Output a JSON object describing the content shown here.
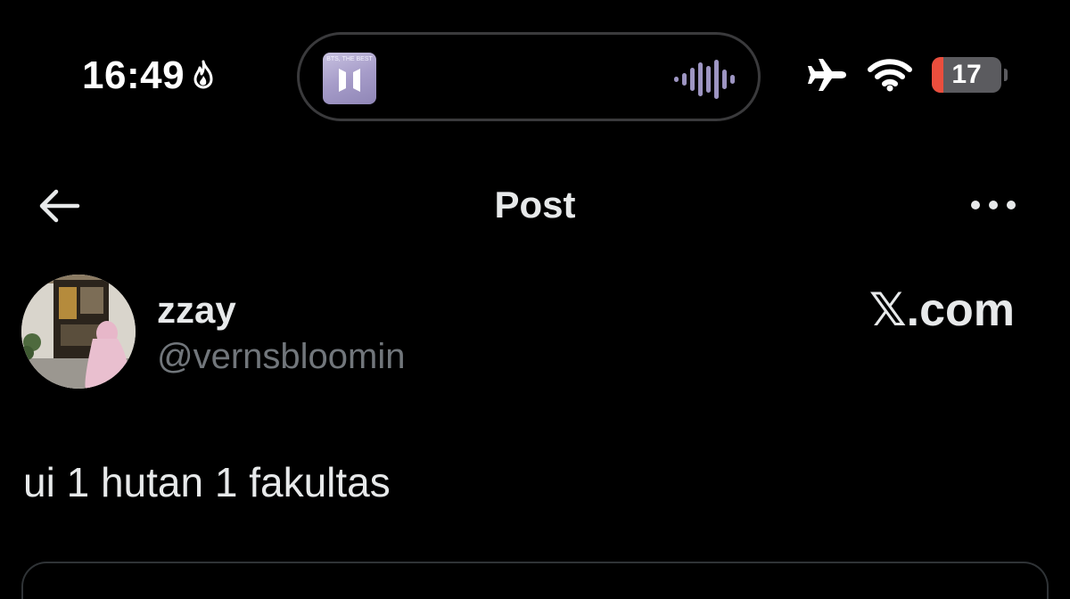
{
  "status_bar": {
    "time": "16:49",
    "battery_level": "17",
    "battery_fraction": 0.17,
    "album_title": "BTS, THE BEST",
    "icons": [
      "flame-icon",
      "airplane-mode-icon",
      "wifi-icon",
      "battery-icon"
    ],
    "accent_album": "#a69cc9",
    "battery_color": "#eb4e3d"
  },
  "header": {
    "title": "Post",
    "back_icon": "back-arrow-icon",
    "more_icon": "more-options-icon"
  },
  "post": {
    "author": {
      "display_name": "zzay",
      "handle": "@vernsbloomin"
    },
    "brand": {
      "symbol": "𝕏",
      "text": ".com"
    },
    "text": "ui 1 hutan 1 fakultas"
  },
  "colors": {
    "background": "#000000",
    "text_primary": "#e7e9ea",
    "text_secondary": "#71767b",
    "border": "#2f3336"
  }
}
